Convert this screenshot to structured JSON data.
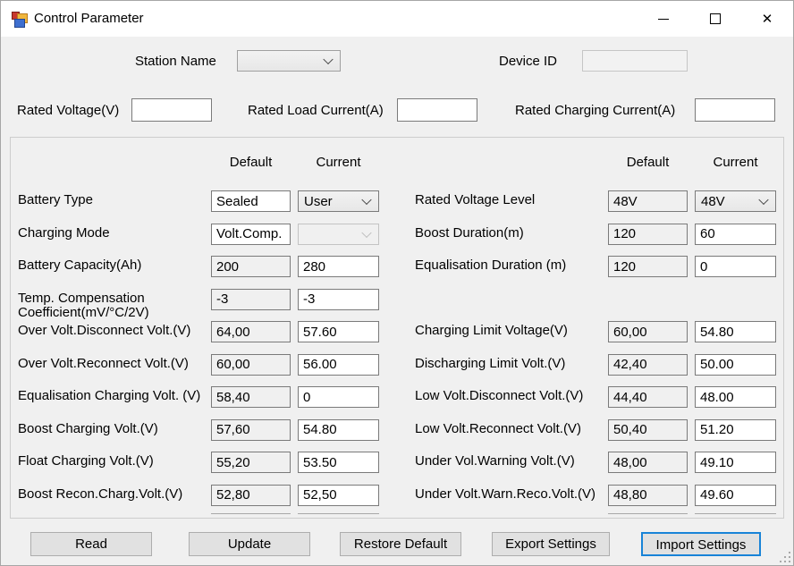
{
  "window": {
    "title": "Control Parameter",
    "icons": {
      "app": "app-icon",
      "minimize": "minimize-icon",
      "maximize": "maximize-icon",
      "close": "close-icon",
      "dropdown": "chevron-down-icon",
      "resize": "resize-grip-icon"
    }
  },
  "top": {
    "station_name_label": "Station Name",
    "station_name_value": "",
    "device_id_label": "Device ID",
    "device_id_value": ""
  },
  "rated": {
    "voltage_label": "Rated Voltage(V)",
    "voltage_value": "",
    "load_current_label": "Rated Load Current(A)",
    "load_current_value": "",
    "charging_current_label": "Rated Charging Current(A)",
    "charging_current_value": ""
  },
  "panel": {
    "headers": {
      "default": "Default",
      "current": "Current"
    },
    "left_rows": [
      {
        "label": "Battery Type",
        "default": "Sealed",
        "default_style": "white",
        "current": "User",
        "current_type": "combo"
      },
      {
        "label": "Charging Mode",
        "default": "Volt.Comp.",
        "default_style": "white",
        "current": "",
        "current_type": "combo_disabled"
      },
      {
        "label": "Battery Capacity(Ah)",
        "default": "200",
        "default_style": "gray",
        "current": "280",
        "current_type": "text"
      },
      {
        "label": "Temp. Compensation Coefficient(mV/°C/2V)",
        "default": "-3",
        "default_style": "gray",
        "current": "-3",
        "current_type": "text"
      },
      {
        "label": "Over Volt.Disconnect Volt.(V)",
        "default": "64,00",
        "default_style": "gray",
        "current": "57.60",
        "current_type": "text"
      },
      {
        "label": "Over Volt.Reconnect Volt.(V)",
        "default": "60,00",
        "default_style": "gray",
        "current": "56.00",
        "current_type": "text"
      },
      {
        "label": "Equalisation Charging Volt. (V)",
        "default": "58,40",
        "default_style": "gray",
        "current": "0",
        "current_type": "text"
      },
      {
        "label": "Boost Charging Volt.(V)",
        "default": "57,60",
        "default_style": "gray",
        "current": "54.80",
        "current_type": "text"
      },
      {
        "label": "Float Charging Volt.(V)",
        "default": "55,20",
        "default_style": "gray",
        "current": "53.50",
        "current_type": "text"
      },
      {
        "label": "Boost Recon.Charg.Volt.(V)",
        "default": "52,80",
        "default_style": "gray",
        "current": "52,50",
        "current_type": "text"
      }
    ],
    "right_rows": [
      {
        "label": "Rated Voltage Level",
        "default": "48V",
        "default_style": "gray",
        "current": "48V",
        "current_type": "combo"
      },
      {
        "label": "Boost Duration(m)",
        "default": "120",
        "default_style": "gray",
        "current": "60",
        "current_type": "text"
      },
      {
        "label": "Equalisation Duration (m)",
        "default": "120",
        "default_style": "gray",
        "current": "0",
        "current_type": "text"
      },
      {
        "type": "spacer"
      },
      {
        "label": "Charging Limit Voltage(V)",
        "default": "60,00",
        "default_style": "gray",
        "current": "54.80",
        "current_type": "text"
      },
      {
        "label": "Discharging Limit Volt.(V)",
        "default": "42,40",
        "default_style": "gray",
        "current": "50.00",
        "current_type": "text"
      },
      {
        "label": "Low Volt.Disconnect Volt.(V)",
        "default": "44,40",
        "default_style": "gray",
        "current": "48.00",
        "current_type": "text"
      },
      {
        "label": "Low Volt.Reconnect Volt.(V)",
        "default": "50,40",
        "default_style": "gray",
        "current": "51.20",
        "current_type": "text"
      },
      {
        "label": "Under Vol.Warning Volt.(V)",
        "default": "48,00",
        "default_style": "gray",
        "current": "49.10",
        "current_type": "text"
      },
      {
        "label": "Under Volt.Warn.Reco.Volt.(V)",
        "default": "48,80",
        "default_style": "gray",
        "current": "49.60",
        "current_type": "text"
      }
    ]
  },
  "buttons": {
    "read": "Read",
    "update": "Update",
    "restore_default": "Restore Default",
    "export_settings": "Export Settings",
    "import_settings": "Import Settings"
  },
  "colors": {
    "accent": "#0078d7",
    "form_bg": "#f0f0f0",
    "titlebar_bg": "#ffffff",
    "button_bg": "#e1e1e1",
    "box_border": "#7a7a7a"
  }
}
